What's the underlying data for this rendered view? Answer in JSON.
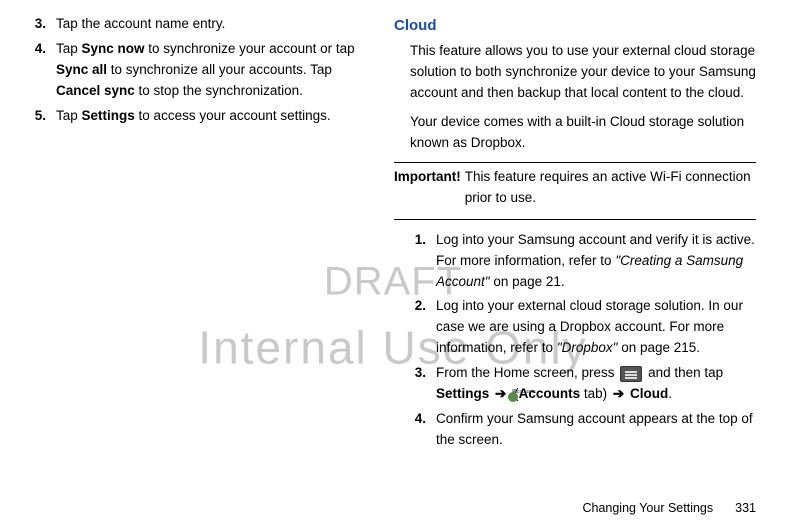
{
  "watermark": {
    "line1": "DRAFT",
    "line2": "Internal Use Only"
  },
  "left": {
    "s3": {
      "num": "3.",
      "t1": "Tap the account name entry."
    },
    "s4": {
      "num": "4.",
      "t1": "Tap ",
      "b1": "Sync now",
      "t2": " to synchronize your account or tap ",
      "b2": "Sync all",
      "t3": " to synchronize all your accounts. Tap ",
      "b3": "Cancel sync",
      "t4": " to stop the synchronization."
    },
    "s5": {
      "num": "5.",
      "t1": "Tap ",
      "b1": "Settings",
      "t2": " to access your account settings."
    }
  },
  "right": {
    "heading": "Cloud",
    "p1": "This feature allows you to use your external cloud storage solution to both synchronize your device to your Samsung account and then backup that local content to the cloud.",
    "p2": "Your device comes with a built-in Cloud storage solution known as Dropbox.",
    "important_label": "Important!",
    "important_text": "This feature requires an active Wi-Fi connection prior to use.",
    "r1": {
      "num": "1.",
      "t1": "Log into your Samsung account and verify it is active. For more information, refer to ",
      "i1": "\"Creating a Samsung Account\"",
      "t2": "  on page 21."
    },
    "r2": {
      "num": "2.",
      "t1": "Log into your external cloud storage solution. In our case we are using a Dropbox account. For more information, refer to ",
      "i1": "\"Dropbox\"",
      "t2": "  on page 215."
    },
    "r3": {
      "num": "3.",
      "t1": "From the Home screen, press ",
      "t2": " and then tap ",
      "b1": "Settings",
      "arrow": "➔",
      "paren1": "(",
      "b2": "Accounts",
      "t3": " tab",
      "paren2": ")",
      "b3": "Cloud",
      "dot": "."
    },
    "r4": {
      "num": "4.",
      "t1": "Confirm your Samsung account appears at the top of the screen."
    },
    "accounts_label": "Accounts"
  },
  "footer": {
    "title": "Changing Your Settings",
    "page": "331"
  }
}
